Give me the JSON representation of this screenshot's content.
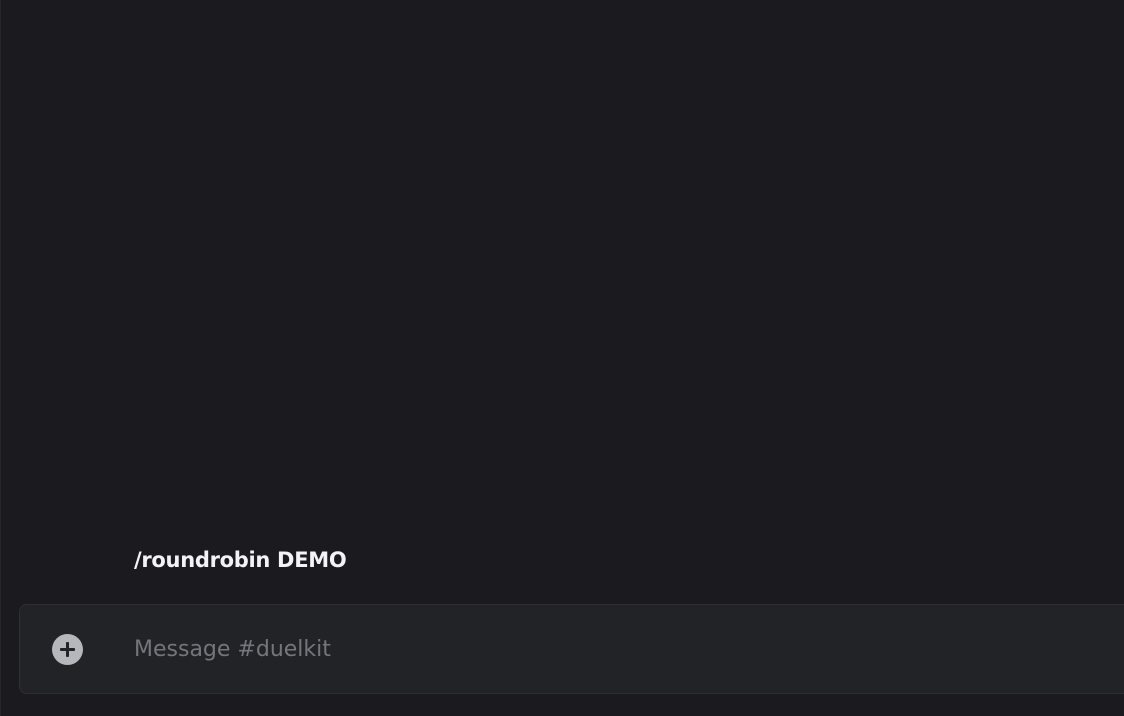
{
  "channel": {
    "name": "duelkit"
  },
  "messages": [
    {
      "text": "/roundrobin DEMO"
    }
  ],
  "composer": {
    "placeholder": "Message #duelkit",
    "value": "",
    "add_icon": "plus-circle-icon"
  },
  "colors": {
    "background": "#1b1b1f",
    "composer_bg": "#222327",
    "text": "#f2f3f5",
    "placeholder": "#74767d",
    "icon": "#b5b7bd"
  }
}
